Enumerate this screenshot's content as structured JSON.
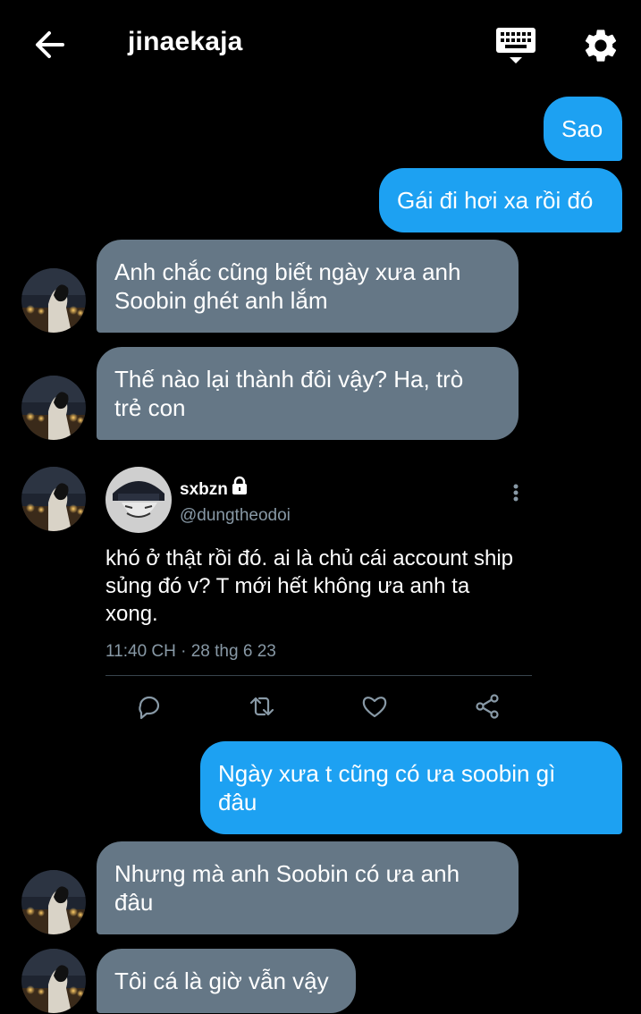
{
  "header": {
    "back_icon": "arrow-left-icon",
    "title": "jinaekaja",
    "keyboard_icon": "keyboard-icon",
    "settings_icon": "gear-icon"
  },
  "messages": [
    {
      "dir": "sent",
      "lines": [
        "Sao"
      ]
    },
    {
      "dir": "sent",
      "lines": [
        "Gái đi hơi xa rồi đó"
      ]
    },
    {
      "dir": "received",
      "lines": [
        "Anh chắc cũng biết ngày xưa anh",
        "Soobin ghét anh lắm"
      ]
    },
    {
      "dir": "received",
      "lines": [
        "Thế nào lại thành đôi vậy? Ha, trò",
        "trẻ con"
      ]
    },
    {
      "dir": "sent",
      "lines": [
        "Ngày xưa t cũng có ưa soobin gì",
        "đâu"
      ]
    },
    {
      "dir": "received",
      "lines": [
        "Nhưng mà anh Soobin có ưa anh",
        "đâu"
      ]
    },
    {
      "dir": "received",
      "lines": [
        "Tôi cá là giờ vẫn vậy"
      ]
    }
  ],
  "shared_tweet": {
    "name": "sxbzn",
    "protected_icon": "lock-icon",
    "handle": "@dungtheodoi",
    "text_lines": [
      "khó ở thật rồi đó. ai là chủ cái account ship",
      "sủng đó v? T mới hết không ưa anh ta",
      "xong."
    ],
    "timestamp": "11:40 CH · 28 thg 6 23",
    "actions": [
      "reply-icon",
      "retweet-icon",
      "like-icon",
      "share-icon"
    ]
  },
  "colors": {
    "sent_bubble": "#1da1f2",
    "received_bubble": "#657786",
    "background": "#000000",
    "secondary_text": "#8899a6"
  }
}
